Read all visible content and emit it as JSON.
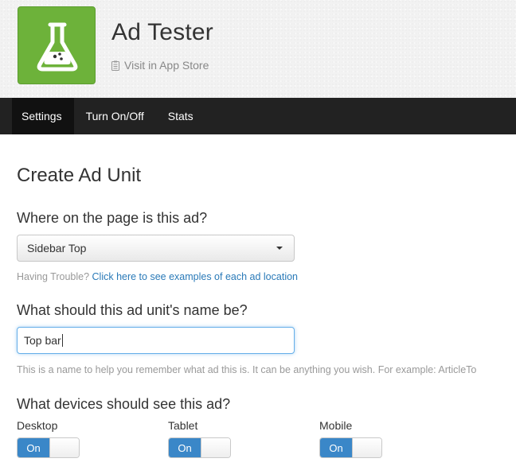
{
  "app": {
    "name": "Ad Tester",
    "store_link": "Visit in App Store",
    "icon": "flask-icon"
  },
  "nav": {
    "tabs": [
      {
        "label": "Settings",
        "active": true
      },
      {
        "label": "Turn On/Off",
        "active": false
      },
      {
        "label": "Stats",
        "active": false
      }
    ]
  },
  "form": {
    "title": "Create Ad Unit",
    "location": {
      "question": "Where on the page is this ad?",
      "selected": "Sidebar Top",
      "help_prefix": "Having Trouble?",
      "help_link": "Click here to see examples of each ad location"
    },
    "name": {
      "question": "What should this ad unit's name be?",
      "value": "Top bar",
      "help": "This is a name to help you remember what ad this is. It can be anything you wish. For example: ArticleTo"
    },
    "devices": {
      "question": "What devices should see this ad?",
      "items": [
        {
          "label": "Desktop",
          "toggle": "On"
        },
        {
          "label": "Tablet",
          "toggle": "On"
        },
        {
          "label": "Mobile",
          "toggle": "On"
        }
      ]
    }
  },
  "colors": {
    "accent": "#3a87c8",
    "icon_bg": "#6db23a",
    "nav_bg": "#222222",
    "link": "#2a7ab8"
  }
}
